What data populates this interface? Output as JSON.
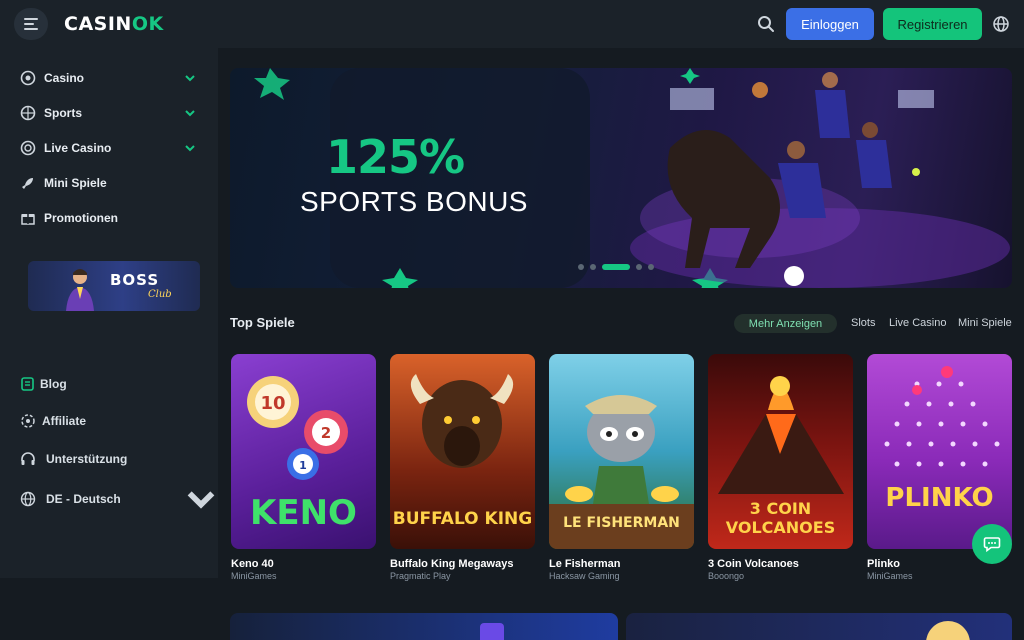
{
  "header": {
    "logo_main": "CASIN",
    "logo_accent": "OK",
    "login_label": "Einloggen",
    "register_label": "Registrieren"
  },
  "sidebar": {
    "items": [
      {
        "label": "Casino",
        "icon": "casino-chip-icon",
        "expandable": true
      },
      {
        "label": "Sports",
        "icon": "basketball-icon",
        "expandable": true
      },
      {
        "label": "Live Casino",
        "icon": "live-chip-icon",
        "expandable": true
      },
      {
        "label": "Mini Spiele",
        "icon": "rocket-icon",
        "expandable": false
      },
      {
        "label": "Promotionen",
        "icon": "gift-icon",
        "expandable": false
      }
    ],
    "promo_banner": {
      "title": "BOSS",
      "subtitle": "Club"
    },
    "footer": [
      {
        "label": "Blog",
        "icon": "blog-icon"
      },
      {
        "label": "Affiliate",
        "icon": "affiliate-icon"
      },
      {
        "label": "Unterstützung",
        "icon": "headset-icon"
      },
      {
        "label": "DE - Deutsch",
        "icon": "globe-icon"
      }
    ]
  },
  "banner": {
    "headline": "125%",
    "subline": "SPORTS BONUS",
    "slides": 5,
    "active_slide": 3
  },
  "top_games": {
    "title": "Top Spiele",
    "more_label": "Mehr Anzeigen",
    "tabs": [
      "Slots",
      "Live Casino",
      "Mini Spiele"
    ],
    "games": [
      {
        "name": "Keno 40",
        "provider": "MiniGames",
        "art": "KENO"
      },
      {
        "name": "Buffalo King Megaways",
        "provider": "Pragmatic Play",
        "art": "BUFFALO KING"
      },
      {
        "name": "Le Fisherman",
        "provider": "Hacksaw Gaming",
        "art": "LE FISHERMAN"
      },
      {
        "name": "3 Coin Volcanoes",
        "provider": "Booongo",
        "art": "3 COIN VOLCANOES"
      },
      {
        "name": "Plinko",
        "provider": "MiniGames",
        "art": "PLINKO"
      }
    ]
  },
  "colors": {
    "accent": "#16c784",
    "login": "#3b6fe6",
    "background": "#151b21",
    "panel": "#1b2229"
  }
}
